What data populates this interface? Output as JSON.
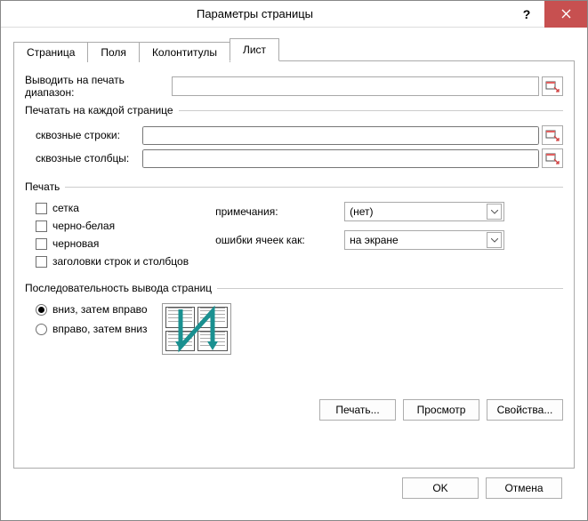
{
  "window": {
    "title": "Параметры страницы"
  },
  "tabs": [
    {
      "label": "Страница"
    },
    {
      "label": "Поля"
    },
    {
      "label": "Колонтитулы"
    },
    {
      "label": "Лист"
    }
  ],
  "active_tab": 3,
  "sheet": {
    "print_range_label": "Выводить на печать диапазон:",
    "print_range_value": "",
    "repeat_group": "Печатать на каждой странице",
    "rows_label": "сквозные строки:",
    "rows_value": "",
    "cols_label": "сквозные столбцы:",
    "cols_value": "",
    "print_group": "Печать",
    "checks": [
      {
        "label": "сетка",
        "checked": false
      },
      {
        "label": "черно-белая",
        "checked": false
      },
      {
        "label": "черновая",
        "checked": false
      },
      {
        "label": "заголовки строк и столбцов",
        "checked": false
      }
    ],
    "comments_label": "примечания:",
    "comments_value": "(нет)",
    "errors_label": "ошибки ячеек как:",
    "errors_value": "на экране",
    "order_group": "Последовательность вывода страниц",
    "order_options": [
      {
        "label": "вниз, затем вправо",
        "checked": true
      },
      {
        "label": "вправо, затем вниз",
        "checked": false
      }
    ]
  },
  "buttons": {
    "print": "Печать...",
    "preview": "Просмотр",
    "props": "Свойства...",
    "ok": "OK",
    "cancel": "Отмена"
  }
}
